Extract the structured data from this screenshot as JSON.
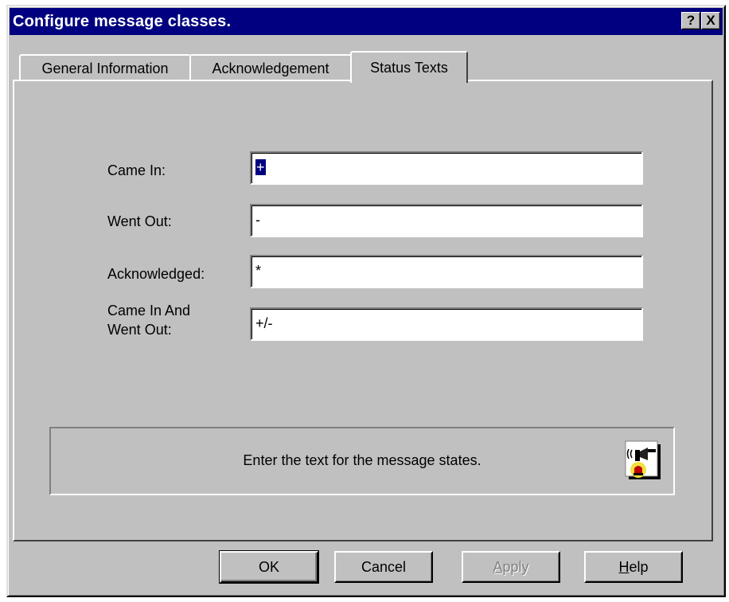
{
  "window": {
    "title": "Configure message classes.",
    "help_button": "?",
    "close_button": "X"
  },
  "tabs": [
    {
      "label": "General Information",
      "active": false
    },
    {
      "label": "Acknowledgement",
      "active": false
    },
    {
      "label": "Status Texts",
      "active": true
    }
  ],
  "fields": [
    {
      "label": "Came In:",
      "value": "+",
      "selected": true
    },
    {
      "label": "Went Out:",
      "value": "-"
    },
    {
      "label": "Acknowledged:",
      "value": "*"
    },
    {
      "label_line1": "Came In And",
      "label_line2": "Went Out:",
      "value": "+/-"
    }
  ],
  "info": {
    "text": "Enter the text for the message states.",
    "icon": "alarm-horn-icon"
  },
  "buttons": {
    "ok": "OK",
    "cancel": "Cancel",
    "apply_first": "A",
    "apply_rest": "pply",
    "help_first": "H",
    "help_rest": "elp"
  },
  "colors": {
    "titlebar": "#000080",
    "dialog_face": "#c0c0c0",
    "selection": "#000080"
  }
}
